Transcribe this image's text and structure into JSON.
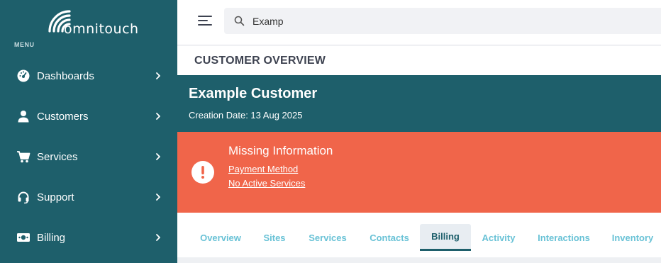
{
  "brand": {
    "logo_text": "omnitouch"
  },
  "sidebar": {
    "menu_label": "MENU",
    "items": [
      {
        "label": "Dashboards",
        "icon": "dashboard-icon"
      },
      {
        "label": "Customers",
        "icon": "user-icon"
      },
      {
        "label": "Services",
        "icon": "cart-icon"
      },
      {
        "label": "Support",
        "icon": "headset-icon"
      },
      {
        "label": "Billing",
        "icon": "cash-icon"
      }
    ]
  },
  "topbar": {
    "search_value": "Examp"
  },
  "page": {
    "title": "CUSTOMER OVERVIEW"
  },
  "customer": {
    "name": "Example Customer",
    "creation_date": "Creation Date: 13 Aug 2025"
  },
  "alert": {
    "title": "Missing Information",
    "links": [
      "Payment Method",
      "No Active Services"
    ]
  },
  "tabs": [
    {
      "label": "Overview",
      "active": false
    },
    {
      "label": "Sites",
      "active": false
    },
    {
      "label": "Services",
      "active": false
    },
    {
      "label": "Contacts",
      "active": false
    },
    {
      "label": "Billing",
      "active": true
    },
    {
      "label": "Activity",
      "active": false
    },
    {
      "label": "Interactions",
      "active": false
    },
    {
      "label": "Inventory",
      "active": false
    }
  ],
  "colors": {
    "sidebar": "#1e5f6b",
    "alert": "#f0654a",
    "tab_text": "#69c2d6",
    "page_title": "#3d4250"
  }
}
